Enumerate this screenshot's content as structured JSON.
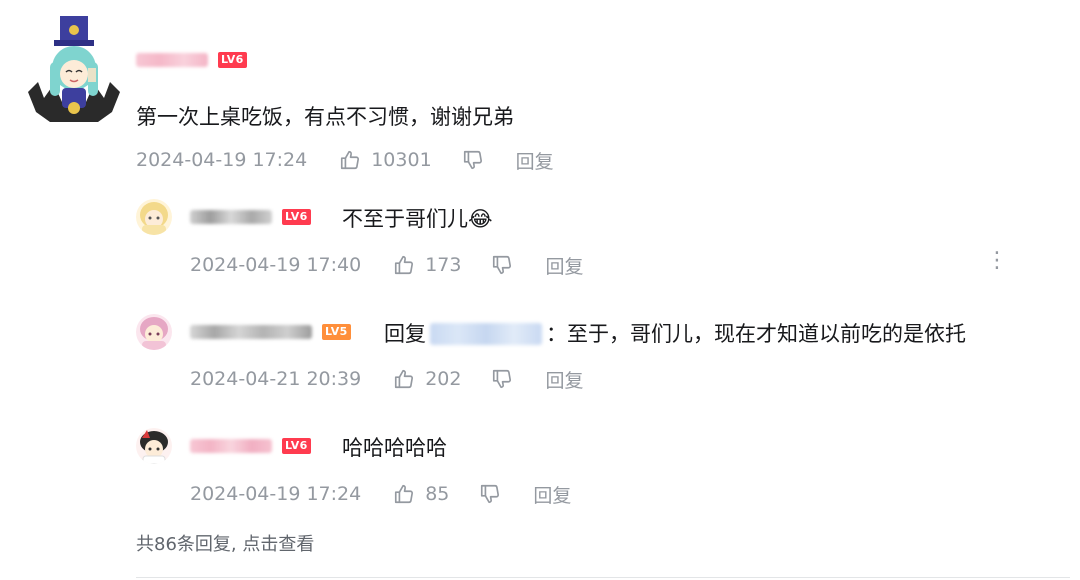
{
  "main_comment": {
    "level": "LV6",
    "text": "第一次上桌吃饭，有点不习惯，谢谢兄弟",
    "date": "2024-04-19 17:24",
    "likes": "10301",
    "reply_label": "回复"
  },
  "replies": [
    {
      "level": "LV6",
      "text": "不至于哥们儿😂",
      "date": "2024-04-19 17:40",
      "likes": "173",
      "reply_label": "回复"
    },
    {
      "level": "LV5",
      "reply_prefix": "回复",
      "text": "：至于，哥们儿，现在才知道以前吃的是依托",
      "date": "2024-04-21 20:39",
      "likes": "202",
      "reply_label": "回复"
    },
    {
      "level": "LV6",
      "text": "哈哈哈哈哈",
      "date": "2024-04-19 17:24",
      "likes": "85",
      "reply_label": "回复"
    }
  ],
  "summary": "共86条回复, 点击查看",
  "more_icon": "⋮",
  "colors": {
    "lv6": "#ff3b4f",
    "lv5": "#ff8f3b",
    "meta": "#9499a0",
    "text": "#18191c"
  }
}
